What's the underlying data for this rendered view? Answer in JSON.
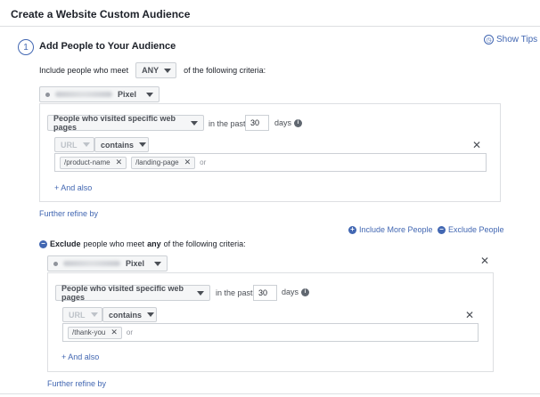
{
  "header": {
    "title": "Create a Website Custom Audience"
  },
  "step": {
    "number": "1",
    "title": "Add People to Your Audience",
    "show_tips": "Show Tips"
  },
  "include": {
    "prefix": "Include people who meet",
    "match": "ANY",
    "suffix": "of the following criteria:",
    "pixel_label": "Pixel",
    "rule": {
      "type": "People who visited specific web pages",
      "in_the_past": "in the past",
      "days_value": "30",
      "days_label": "days",
      "field": "URL",
      "operator": "contains",
      "tokens": [
        "/product-name",
        "/landing-page"
      ],
      "or": "or",
      "and_also": "+ And also"
    },
    "further_refine": "Further refine by"
  },
  "actions": {
    "include_more": "Include More People",
    "exclude": "Exclude People"
  },
  "exclude": {
    "bold": "Exclude",
    "mid": "people who meet",
    "any": "any",
    "suffix": "of the following criteria:",
    "pixel_label": "Pixel",
    "rule": {
      "type": "People who visited specific web pages",
      "in_the_past": "in the past",
      "days_value": "30",
      "days_label": "days",
      "field": "URL",
      "operator": "contains",
      "tokens": [
        "/thank-you"
      ],
      "or": "or",
      "and_also": "+ And also"
    },
    "further_refine": "Further refine by"
  },
  "icons": {
    "tips": "clock-icon",
    "remove": "close-icon",
    "info": "info-icon",
    "add": "plus-circle-icon",
    "exclude": "minus-circle-icon",
    "dropdown": "caret-down-icon"
  },
  "colors": {
    "accent": "#4267b2",
    "border": "#dddfe2",
    "text": "#1d2129"
  }
}
